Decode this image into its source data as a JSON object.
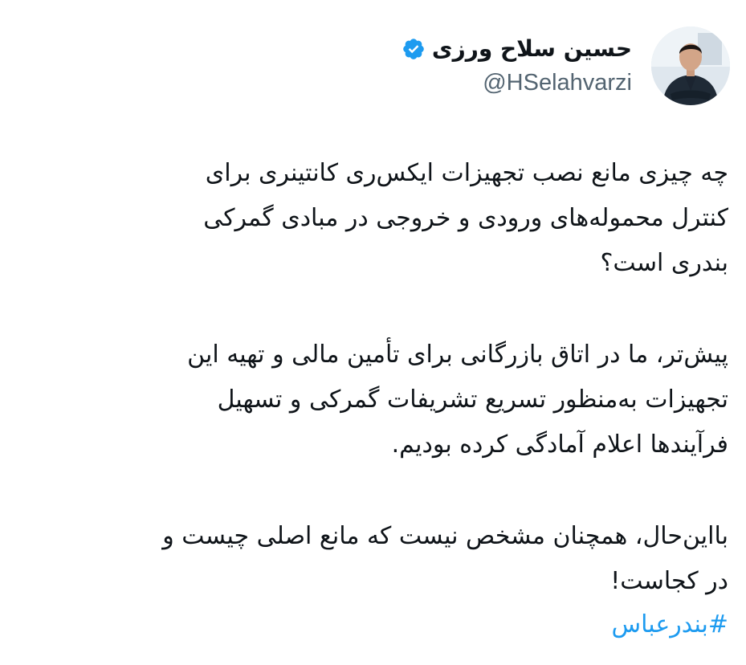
{
  "author": {
    "display_name": "حسین سلاح ورزی",
    "handle": "@HSelahvarzi",
    "verified": true,
    "verified_color": "#1d9bf0"
  },
  "tweet": {
    "paragraphs": [
      {
        "lines": [
          "چه چیزی مانع نصب تجهیزات ایکس‌ری کانتینری برای",
          "کنترل محموله‌های ورودی و خروجی در مبادی گمرکی",
          "بندری است؟"
        ]
      },
      {
        "lines": [
          "پیش‌تر، ما در اتاق بازرگانی برای تأمین مالی و تهیه این",
          "تجهیزات به‌منظور تسریع تشریفات گمرکی و تسهیل",
          "فرآیندها اعلام آمادگی کرده بودیم."
        ]
      },
      {
        "lines": [
          "بااین‌حال، همچنان مشخص نیست که مانع اصلی چیست و",
          "در کجاست!"
        ]
      }
    ],
    "hashtag": "#بندرعباس",
    "hashtag_color": "#1d9bf0"
  }
}
